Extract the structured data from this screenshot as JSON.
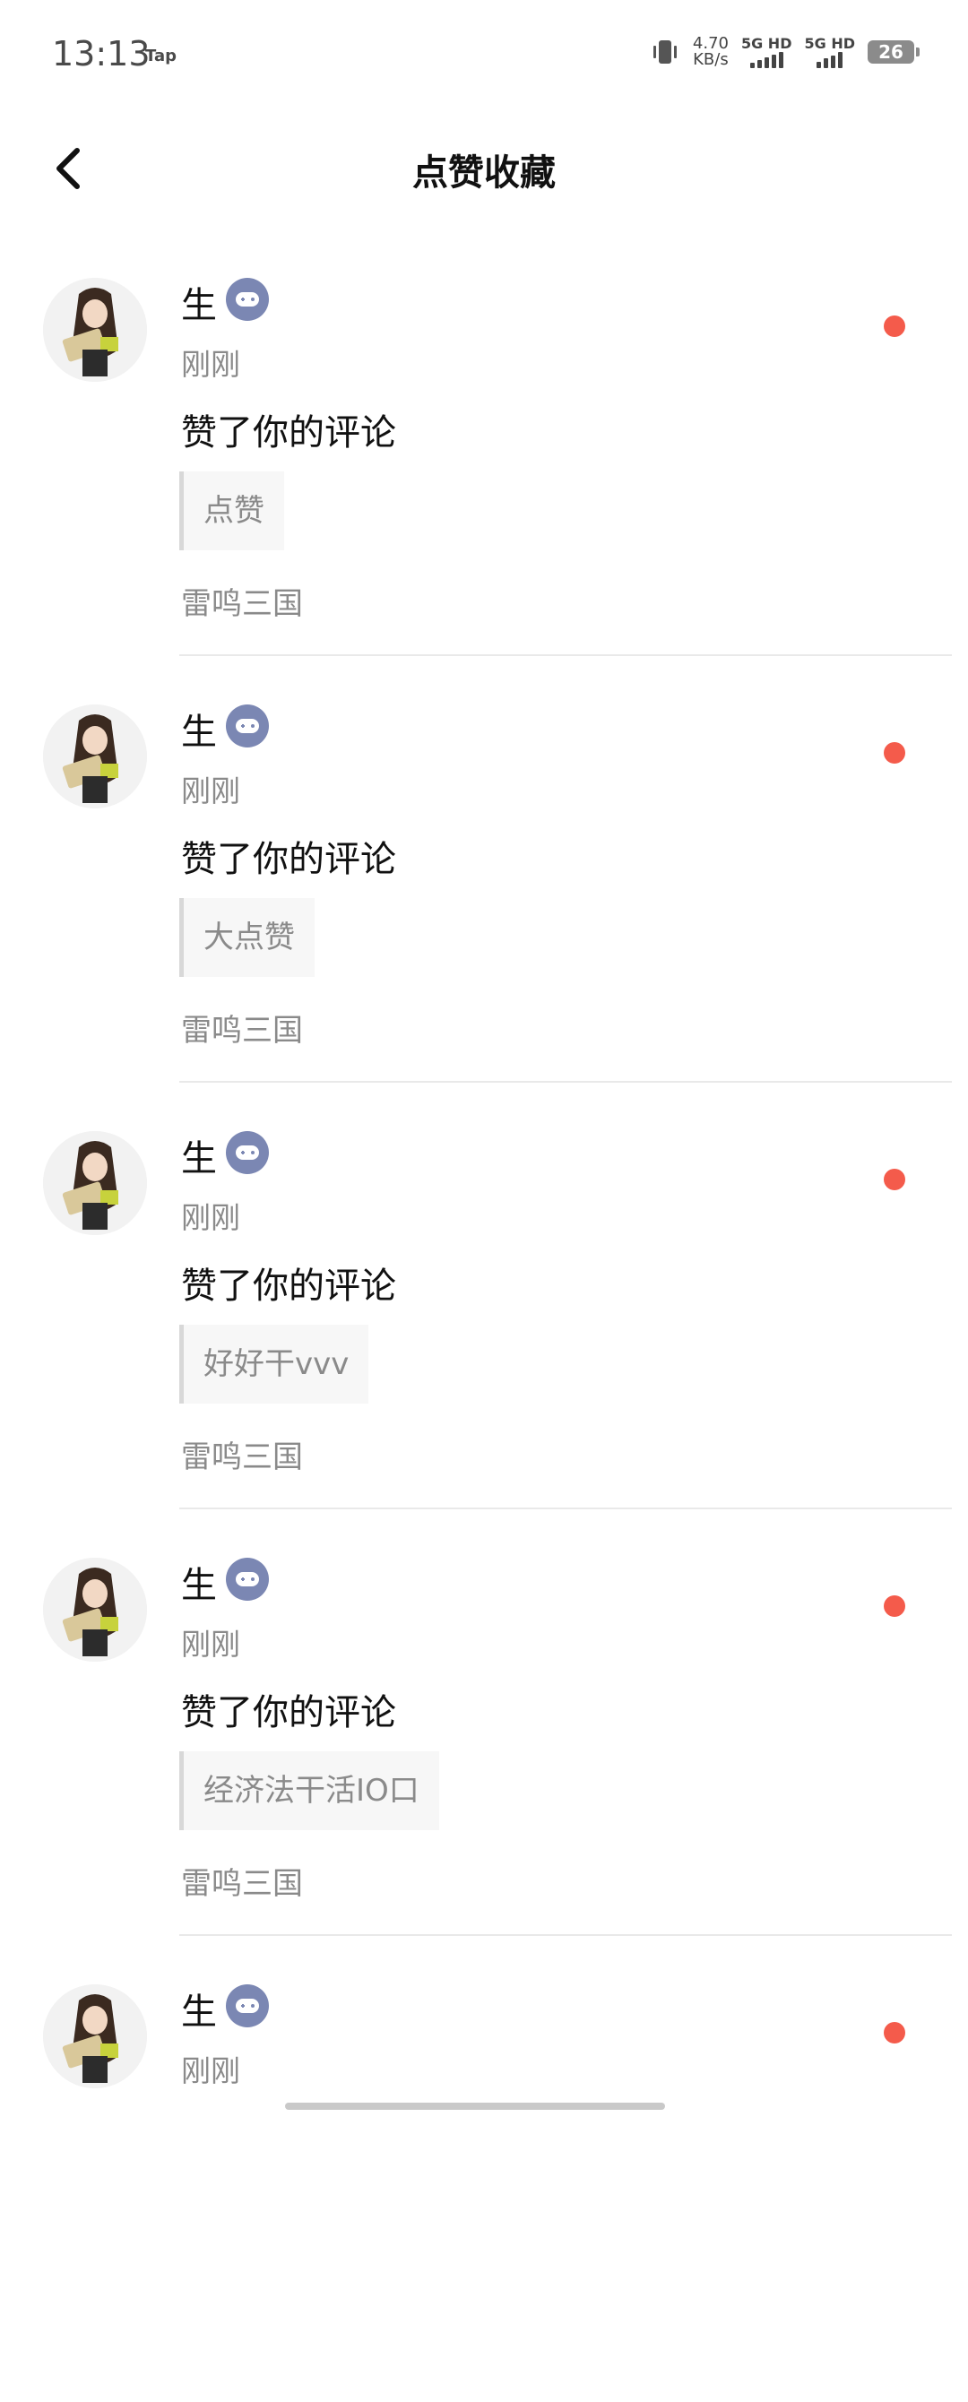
{
  "status_bar": {
    "time": "13:13",
    "app_label": "Tap",
    "net_speed_value": "4.70",
    "net_speed_unit": "KB/s",
    "sim1_label": "5G HD",
    "sim2_label": "5G HD",
    "battery": "26"
  },
  "header": {
    "title": "点赞收藏",
    "back_icon": "chevron-left-icon"
  },
  "colors": {
    "unread_dot": "#f45b4b",
    "badge": "#7b87b3"
  },
  "items": [
    {
      "user": "生",
      "time": "刚刚",
      "action": "赞了你的评论",
      "quote": "点赞",
      "game": "雷鸣三国"
    },
    {
      "user": "生",
      "time": "刚刚",
      "action": "赞了你的评论",
      "quote": "大点赞",
      "game": "雷鸣三国"
    },
    {
      "user": "生",
      "time": "刚刚",
      "action": "赞了你的评论",
      "quote": "好好干vvv",
      "game": "雷鸣三国"
    },
    {
      "user": "生",
      "time": "刚刚",
      "action": "赞了你的评论",
      "quote": "经济法干活IO口",
      "game": "雷鸣三国"
    },
    {
      "user": "生",
      "time": "刚刚",
      "action": "",
      "quote": "",
      "game": ""
    }
  ]
}
